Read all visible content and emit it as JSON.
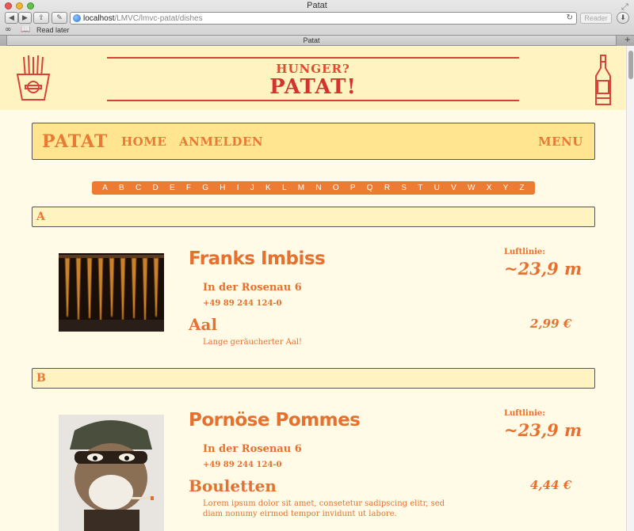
{
  "browser": {
    "window_title": "Patat",
    "url_host": "localhost",
    "url_path": "/LMVC/lmvc-patat/dishes",
    "reader_label": "Reader",
    "bookmark_label": "Read later",
    "tab_title": "Patat",
    "traffic_lights": [
      "#ee5a52",
      "#f2b632",
      "#5fc24d"
    ]
  },
  "header": {
    "tagline": "HUNGER?",
    "brand": "PATAT!"
  },
  "nav": {
    "brand": "PATAT",
    "links": [
      "HOME",
      "ANMELDEN"
    ],
    "menu": "MENU"
  },
  "alphabet": [
    "A",
    "B",
    "C",
    "D",
    "E",
    "F",
    "G",
    "H",
    "I",
    "J",
    "K",
    "L",
    "M",
    "N",
    "O",
    "P",
    "Q",
    "R",
    "S",
    "T",
    "U",
    "V",
    "W",
    "X",
    "Y",
    "Z"
  ],
  "sections": [
    {
      "letter": "A",
      "shop": "Franks Imbiss",
      "address": "In der Rosenau 6",
      "phone": "+49 89 244 124-0",
      "dist_label": "Luftlinie:",
      "distance": "~23,9 m",
      "dish": "Aal",
      "description": "Lange geräucherter Aal!",
      "price": "2,99 €"
    },
    {
      "letter": "B",
      "shop": "Pornöse Pommes",
      "address": "In der Rosenau 6",
      "phone": "+49 89 244 124-0",
      "dist_label": "Luftlinie:",
      "distance": "~23,9 m",
      "dish": "Bouletten",
      "description": "Lorem ipsum dolor sit amet, consetetur sadipscing elitr, sed diam nonumy eirmod tempor invidunt ut labore.",
      "price": "4,44 €"
    }
  ],
  "colors": {
    "accent": "#e8702e",
    "brand_red": "#d1342b",
    "nav_bg": "#ffe58f",
    "page_bg": "#fffbe6"
  }
}
